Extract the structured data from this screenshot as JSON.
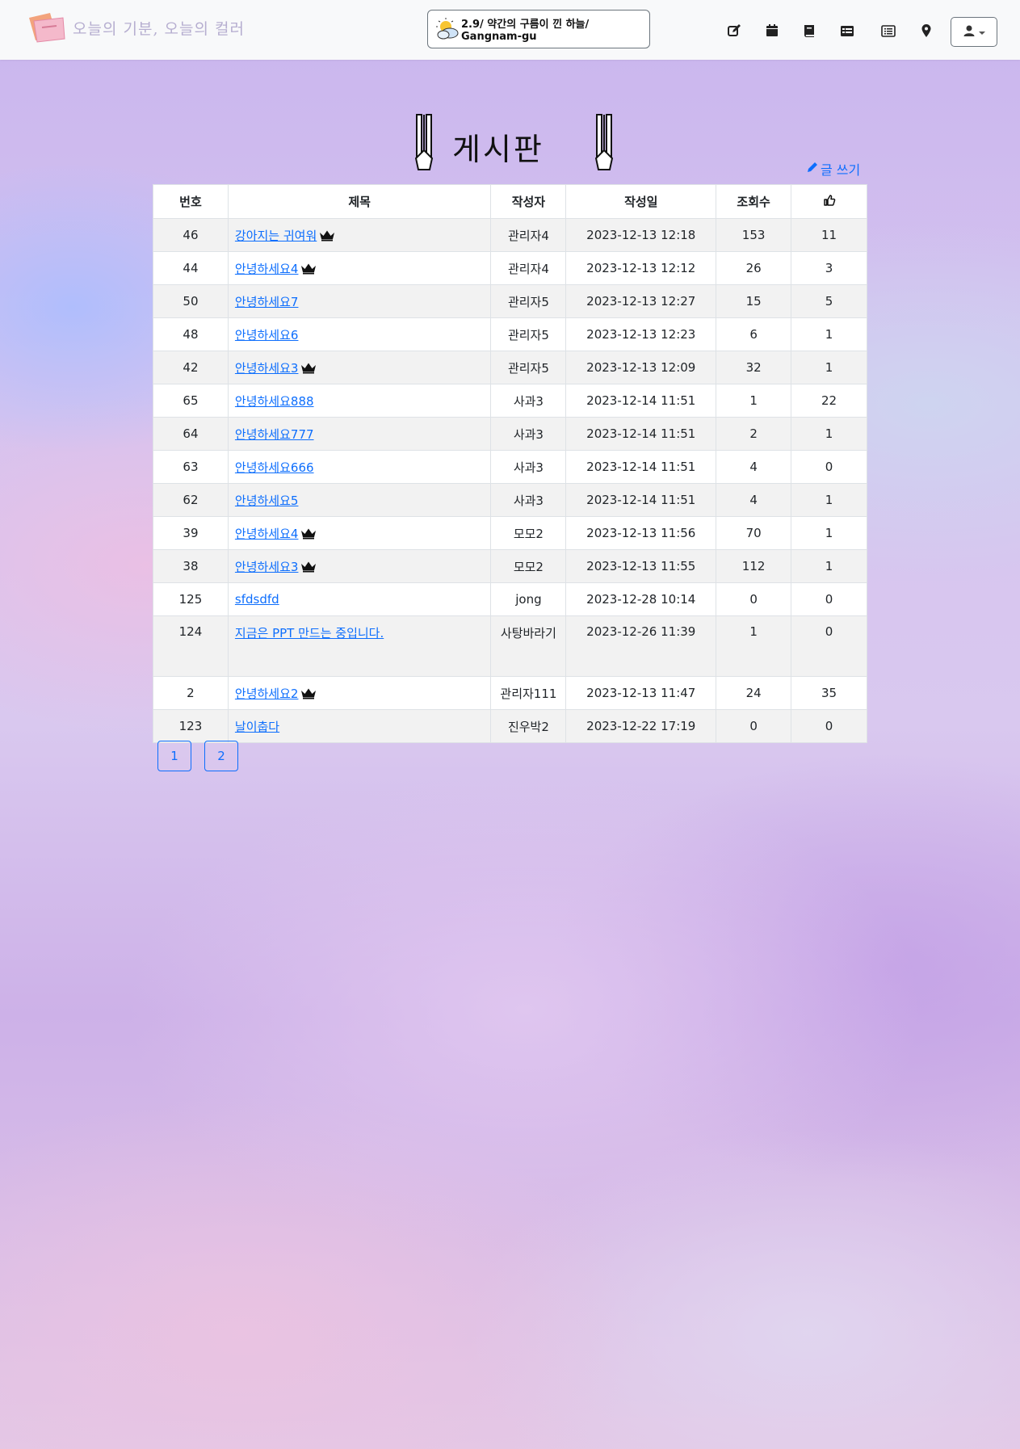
{
  "brand": {
    "text": "오늘의 기분, 오늘의 컬러"
  },
  "weather": {
    "text": "2.9/ 약간의 구름이 낀 하늘/ Gangnam-gu"
  },
  "board": {
    "title": "게시판",
    "write_label": "글 쓰기",
    "columns": [
      "번호",
      "제목",
      "작성자",
      "작성일",
      "조회수"
    ],
    "rows": [
      {
        "no": "46",
        "title": "강아지는 귀여워",
        "author": "관리자4",
        "date": "2023-12-13 12:18",
        "views": "153",
        "likes": "11"
      },
      {
        "no": "44",
        "title": "안녕하세요4",
        "author": "관리자4",
        "date": "2023-12-13 12:12",
        "views": "26",
        "likes": "3"
      },
      {
        "no": "50",
        "title": "안녕하세요7",
        "author": "관리자5",
        "date": "2023-12-13 12:27",
        "views": "15",
        "likes": "5"
      },
      {
        "no": "48",
        "title": "안녕하세요6",
        "author": "관리자5",
        "date": "2023-12-13 12:23",
        "views": "6",
        "likes": "1"
      },
      {
        "no": "42",
        "title": "안녕하세요3",
        "author": "관리자5",
        "date": "2023-12-13 12:09",
        "views": "32",
        "likes": "1"
      },
      {
        "no": "65",
        "title": "안녕하세요888",
        "author": "사과3",
        "date": "2023-12-14 11:51",
        "views": "1",
        "likes": "22"
      },
      {
        "no": "64",
        "title": "안녕하세요777",
        "author": "사과3",
        "date": "2023-12-14 11:51",
        "views": "2",
        "likes": "1"
      },
      {
        "no": "63",
        "title": "안녕하세요666",
        "author": "사과3",
        "date": "2023-12-14 11:51",
        "views": "4",
        "likes": "0"
      },
      {
        "no": "62",
        "title": "안녕하세요5",
        "author": "사과3",
        "date": "2023-12-14 11:51",
        "views": "4",
        "likes": "1"
      },
      {
        "no": "39",
        "title": "안녕하세요4",
        "author": "모모2",
        "date": "2023-12-13 11:56",
        "views": "70",
        "likes": "1"
      },
      {
        "no": "38",
        "title": "안녕하세요3",
        "author": "모모2",
        "date": "2023-12-13 11:55",
        "views": "112",
        "likes": "1"
      },
      {
        "no": "125",
        "title": "sfdsdfd",
        "author": "jong",
        "date": "2023-12-28 10:14",
        "views": "0",
        "likes": "0"
      },
      {
        "no": "124",
        "title": "지금은 PPT 만드는 중입니다.",
        "author": "사탕바라기",
        "date": "2023-12-26 11:39",
        "views": "1",
        "likes": "0"
      },
      {
        "no": "2",
        "title": "안녕하세요2",
        "author": "관리자111",
        "date": "2023-12-13 11:47",
        "views": "24",
        "likes": "35"
      },
      {
        "no": "123",
        "title": "날이춥다",
        "author": "진우박2",
        "date": "2023-12-22 17:19",
        "views": "0",
        "likes": "0"
      }
    ]
  },
  "pagination": [
    "1",
    "2"
  ],
  "colors": {
    "link": "#0d6efd",
    "navbar": "#f8f9fa"
  }
}
